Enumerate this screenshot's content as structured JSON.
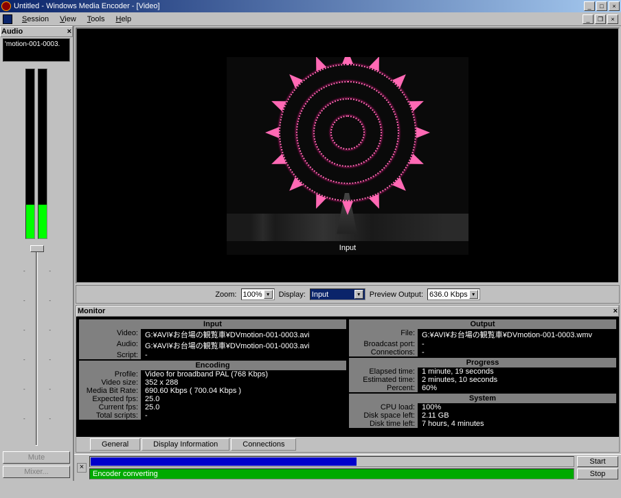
{
  "window": {
    "title": "Untitled - Windows Media Encoder - [Video]"
  },
  "menu": {
    "session": "Session",
    "view": "View",
    "tools": "Tools",
    "help": "Help"
  },
  "audio": {
    "panel_title": "Audio",
    "source": "'motion-001-0003.",
    "mute": "Mute",
    "mixer": "Mixer..."
  },
  "video": {
    "overlay": "Input"
  },
  "zoombar": {
    "zoom_label": "Zoom:",
    "zoom_value": "100%",
    "display_label": "Display:",
    "display_value": "Input",
    "preview_label": "Preview Output:",
    "preview_value": "636.0 Kbps"
  },
  "monitor": {
    "title": "Monitor",
    "input": {
      "header": "Input",
      "video_l": "Video:",
      "video_v": "G:¥AVI¥お台場の観覧車¥DVmotion-001-0003.avi",
      "audio_l": "Audio:",
      "audio_v": "G:¥AVI¥お台場の観覧車¥DVmotion-001-0003.avi",
      "script_l": "Script:",
      "script_v": "-"
    },
    "encoding": {
      "header": "Encoding",
      "profile_l": "Profile:",
      "profile_v": "Video for broadband PAL (768 Kbps)",
      "size_l": "Video size:",
      "size_v": "352 x 288",
      "bitrate_l": "Media Bit Rate:",
      "bitrate_v": "690.60 Kbps ( 700.04 Kbps )",
      "exp_l": "Expected fps:",
      "exp_v": "25.0",
      "cur_l": "Current fps:",
      "cur_v": "25.0",
      "scripts_l": "Total scripts:",
      "scripts_v": "-"
    },
    "output": {
      "header": "Output",
      "file_l": "File:",
      "file_v": "G:¥AVI¥お台場の観覧車¥DVmotion-001-0003.wmv",
      "port_l": "Broadcast port:",
      "port_v": "-",
      "conn_l": "Connections:",
      "conn_v": "-"
    },
    "progress": {
      "header": "Progress",
      "elapsed_l": "Elapsed time:",
      "elapsed_v": "1 minute, 19 seconds",
      "est_l": "Estimated time:",
      "est_v": "2 minutes, 10 seconds",
      "pct_l": "Percent:",
      "pct_v": "60%"
    },
    "system": {
      "header": "System",
      "cpu_l": "CPU load:",
      "cpu_v": "100%",
      "disk_l": "Disk space left:",
      "disk_v": "2.11 GB",
      "time_l": "Disk time left:",
      "time_v": "7 hours, 4 minutes"
    },
    "tabs": {
      "general": "General",
      "display": "Display Information",
      "conn": "Connections"
    }
  },
  "bottom": {
    "status": "Encoder converting",
    "start": "Start",
    "stop": "Stop"
  }
}
